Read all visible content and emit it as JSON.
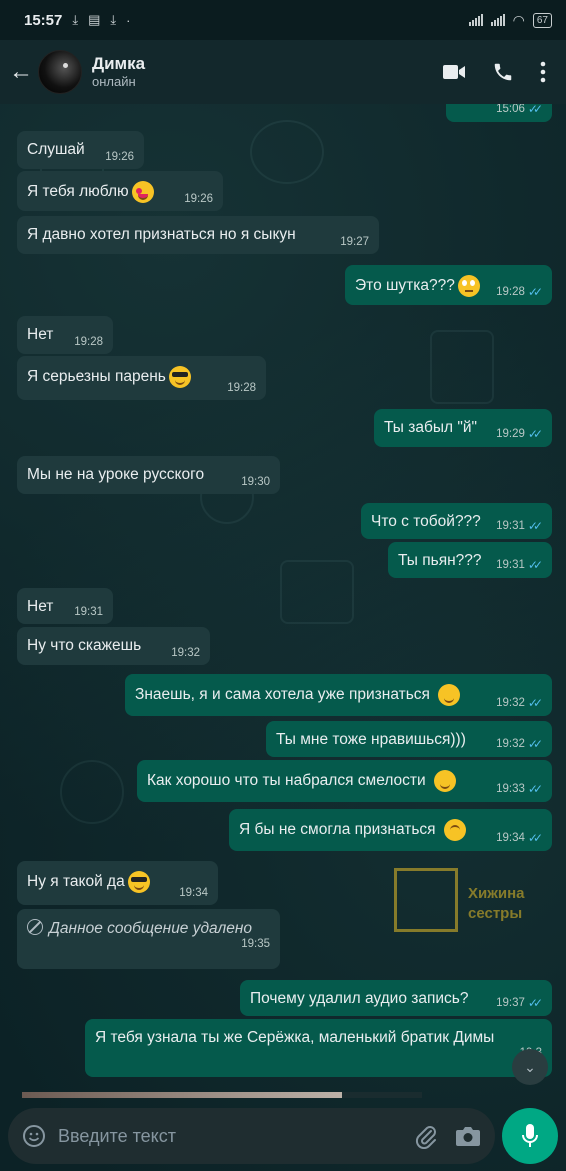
{
  "status_bar": {
    "time": "15:57",
    "battery": "67"
  },
  "header": {
    "contact_name": "Димка",
    "contact_status": "онлайн"
  },
  "messages": [
    {
      "dir": "out",
      "text": "",
      "time": "15:06",
      "read": true
    },
    {
      "dir": "in",
      "text": "Слушай",
      "time": "19:26"
    },
    {
      "dir": "in",
      "text": "Я тебя люблю",
      "time": "19:26",
      "emoji": "heart-eyes-emoji"
    },
    {
      "dir": "in",
      "text": "Я давно хотел признаться но я сыкун",
      "time": "19:27"
    },
    {
      "dir": "out",
      "text": "Это шутка???",
      "time": "19:28",
      "emoji": "eye-roll-emoji",
      "read": true
    },
    {
      "dir": "in",
      "text": "Нет",
      "time": "19:28"
    },
    {
      "dir": "in",
      "text": "Я серьезны парень",
      "time": "19:28",
      "emoji": "sunglasses-emoji"
    },
    {
      "dir": "out",
      "text": "Ты забыл \"й\"",
      "time": "19:29",
      "read": true
    },
    {
      "dir": "in",
      "text": "Мы не на уроке русского",
      "time": "19:30"
    },
    {
      "dir": "out",
      "text": "Что с тобой???",
      "time": "19:31",
      "read": true
    },
    {
      "dir": "out",
      "text": "Ты пьян???",
      "time": "19:31",
      "read": true
    },
    {
      "dir": "in",
      "text": "Нет",
      "time": "19:31"
    },
    {
      "dir": "in",
      "text": "Ну что скажешь",
      "time": "19:32"
    },
    {
      "dir": "out",
      "text": "Знаешь, я и сама хотела уже признаться",
      "time": "19:32",
      "emoji": "smile-emoji",
      "read": true
    },
    {
      "dir": "out",
      "text": "Ты мне тоже нравишься)))",
      "time": "19:32",
      "read": true
    },
    {
      "dir": "out",
      "text": "Как хорошо что ты набрался смелости",
      "time": "19:33",
      "emoji": "relieved-emoji",
      "read": true
    },
    {
      "dir": "out",
      "text": "Я бы не смогла признаться",
      "time": "19:34",
      "emoji": "upside-down-emoji",
      "read": true
    },
    {
      "dir": "in",
      "text": "Ну я такой да",
      "time": "19:34",
      "emoji": "sunglasses-emoji"
    },
    {
      "dir": "in",
      "text": "Данное сообщение удалено",
      "time": "19:35",
      "deleted": true
    },
    {
      "dir": "out",
      "text": "Почему удалил аудио запись?",
      "time": "19:37",
      "read": true
    },
    {
      "dir": "out",
      "text": "Я тебя узнала ты же Серёжка, маленький братик Димы",
      "time": "19:3"
    }
  ],
  "watermark": {
    "line1": "Хижина",
    "line2": "сестры"
  },
  "media_progress": 0.8,
  "composer": {
    "placeholder": "Введите текст"
  },
  "colors": {
    "incoming": "#1f3a3d",
    "outgoing": "#055a4c",
    "accent": "#00a884",
    "read_tick": "#53bdeb"
  }
}
